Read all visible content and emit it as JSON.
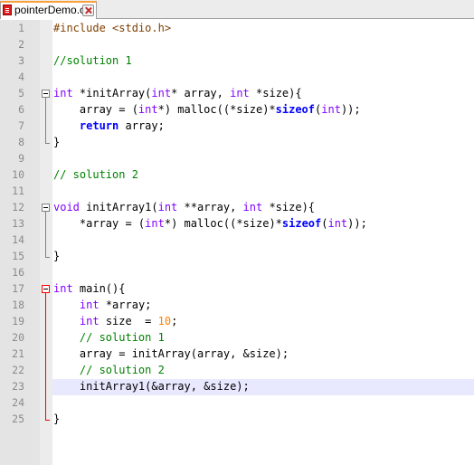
{
  "tab": {
    "title": "pointerDemo.c"
  },
  "line_numbers": [
    "1",
    "2",
    "3",
    "4",
    "5",
    "6",
    "7",
    "8",
    "9",
    "10",
    "11",
    "12",
    "13",
    "14",
    "15",
    "16",
    "17",
    "18",
    "19",
    "20",
    "21",
    "22",
    "23",
    "24",
    "25"
  ],
  "code": {
    "l1": {
      "a": "#include <stdio.h>"
    },
    "l3": {
      "a": "//solution 1"
    },
    "l5": {
      "a": "int",
      "b": " *initArray(",
      "c": "int",
      "d": "* array, ",
      "e": "int",
      "f": " *size){"
    },
    "l6": {
      "a": "    array = (",
      "b": "int",
      "c": "*) malloc((*size)*",
      "d": "sizeof",
      "e": "(",
      "f": "int",
      "g": "));"
    },
    "l7": {
      "a": "    ",
      "b": "return",
      "c": " array;"
    },
    "l8": {
      "a": "}"
    },
    "l10": {
      "a": "// solution 2"
    },
    "l12": {
      "a": "void",
      "b": " initArray1(",
      "c": "int",
      "d": " **array, ",
      "e": "int",
      "f": " *size){"
    },
    "l13": {
      "a": "    *array = (",
      "b": "int",
      "c": "*) malloc((*size)*",
      "d": "sizeof",
      "e": "(",
      "f": "int",
      "g": "));"
    },
    "l15": {
      "a": "}"
    },
    "l17": {
      "a": "int",
      "b": " main(){"
    },
    "l18": {
      "a": "    ",
      "b": "int",
      "c": " *array;"
    },
    "l19": {
      "a": "    ",
      "b": "int",
      "c": " size  = ",
      "d": "10",
      "e": ";"
    },
    "l20": {
      "a": "    // solution 1"
    },
    "l21": {
      "a": "    array = initArray(array, &size);"
    },
    "l22": {
      "a": "    // solution 2"
    },
    "l23": {
      "a": "    initArray1(&array, &size);"
    },
    "l25": {
      "a": "}"
    }
  },
  "colors": {
    "keyword": "#8000ff",
    "control_keyword": "#0000ff",
    "comment": "#008000",
    "number": "#ff8000",
    "preprocessor": "#804000",
    "current_line": "#e8e8ff",
    "active_fold": "#ff0000"
  }
}
